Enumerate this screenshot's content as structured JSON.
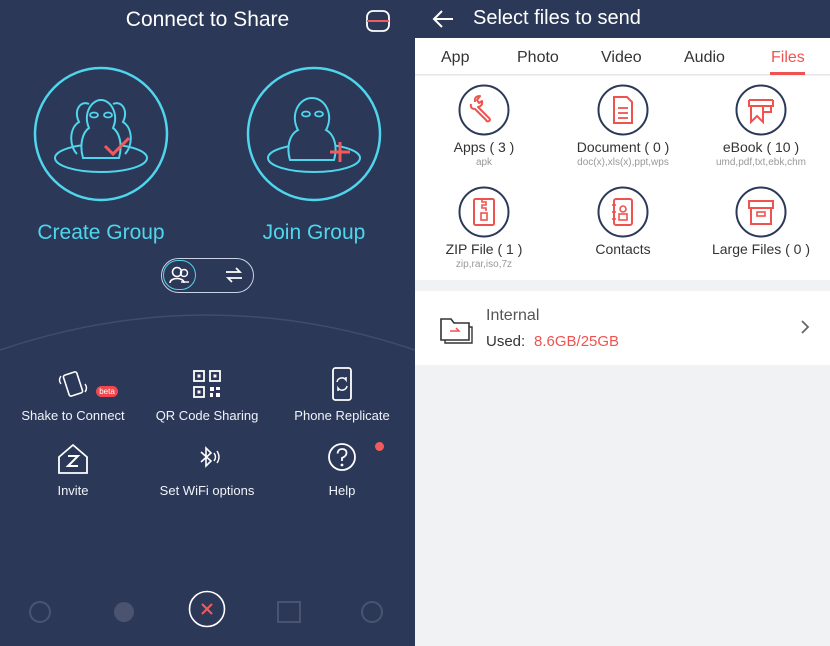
{
  "left": {
    "title": "Connect to Share",
    "create_group": "Create Group",
    "join_group": "Join Group",
    "features": [
      {
        "label": "Shake to Connect",
        "icon": "shake-phone-icon"
      },
      {
        "label": "QR Code Sharing",
        "icon": "qr-code-icon"
      },
      {
        "label": "Phone Replicate",
        "icon": "phone-replicate-icon"
      },
      {
        "label": "Invite",
        "icon": "invite-icon"
      },
      {
        "label": "Set WiFi options",
        "icon": "bluetooth-wifi-icon"
      },
      {
        "label": "Help",
        "icon": "help-icon"
      }
    ],
    "beta_badge": "beta"
  },
  "right": {
    "title": "Select files to send",
    "tabs": [
      "App",
      "Photo",
      "Video",
      "Audio",
      "Files"
    ],
    "active_tab": "Files",
    "categories": [
      {
        "label": "Apps ( 3 )",
        "sub": "apk",
        "icon": "wrench-icon"
      },
      {
        "label": "Document ( 0 )",
        "sub": "doc(x),xls(x),ppt,wps",
        "icon": "document-icon"
      },
      {
        "label": "eBook ( 10 )",
        "sub": "umd,pdf,txt,ebk,chm",
        "icon": "ebook-icon"
      },
      {
        "label": "ZIP File ( 1 )",
        "sub": "zip,rar,iso,7z",
        "icon": "zip-icon"
      },
      {
        "label": "Contacts",
        "sub": "",
        "icon": "contacts-icon"
      },
      {
        "label": "Large Files ( 0 )",
        "sub": "",
        "icon": "large-files-icon"
      }
    ],
    "storage": {
      "name": "Internal",
      "used_label": "Used:",
      "used_value": "8.6GB/25GB"
    }
  },
  "colors": {
    "panel_bg": "#2c3858",
    "cyan_accent": "#4fd6ec",
    "red_accent": "#ef5350"
  }
}
